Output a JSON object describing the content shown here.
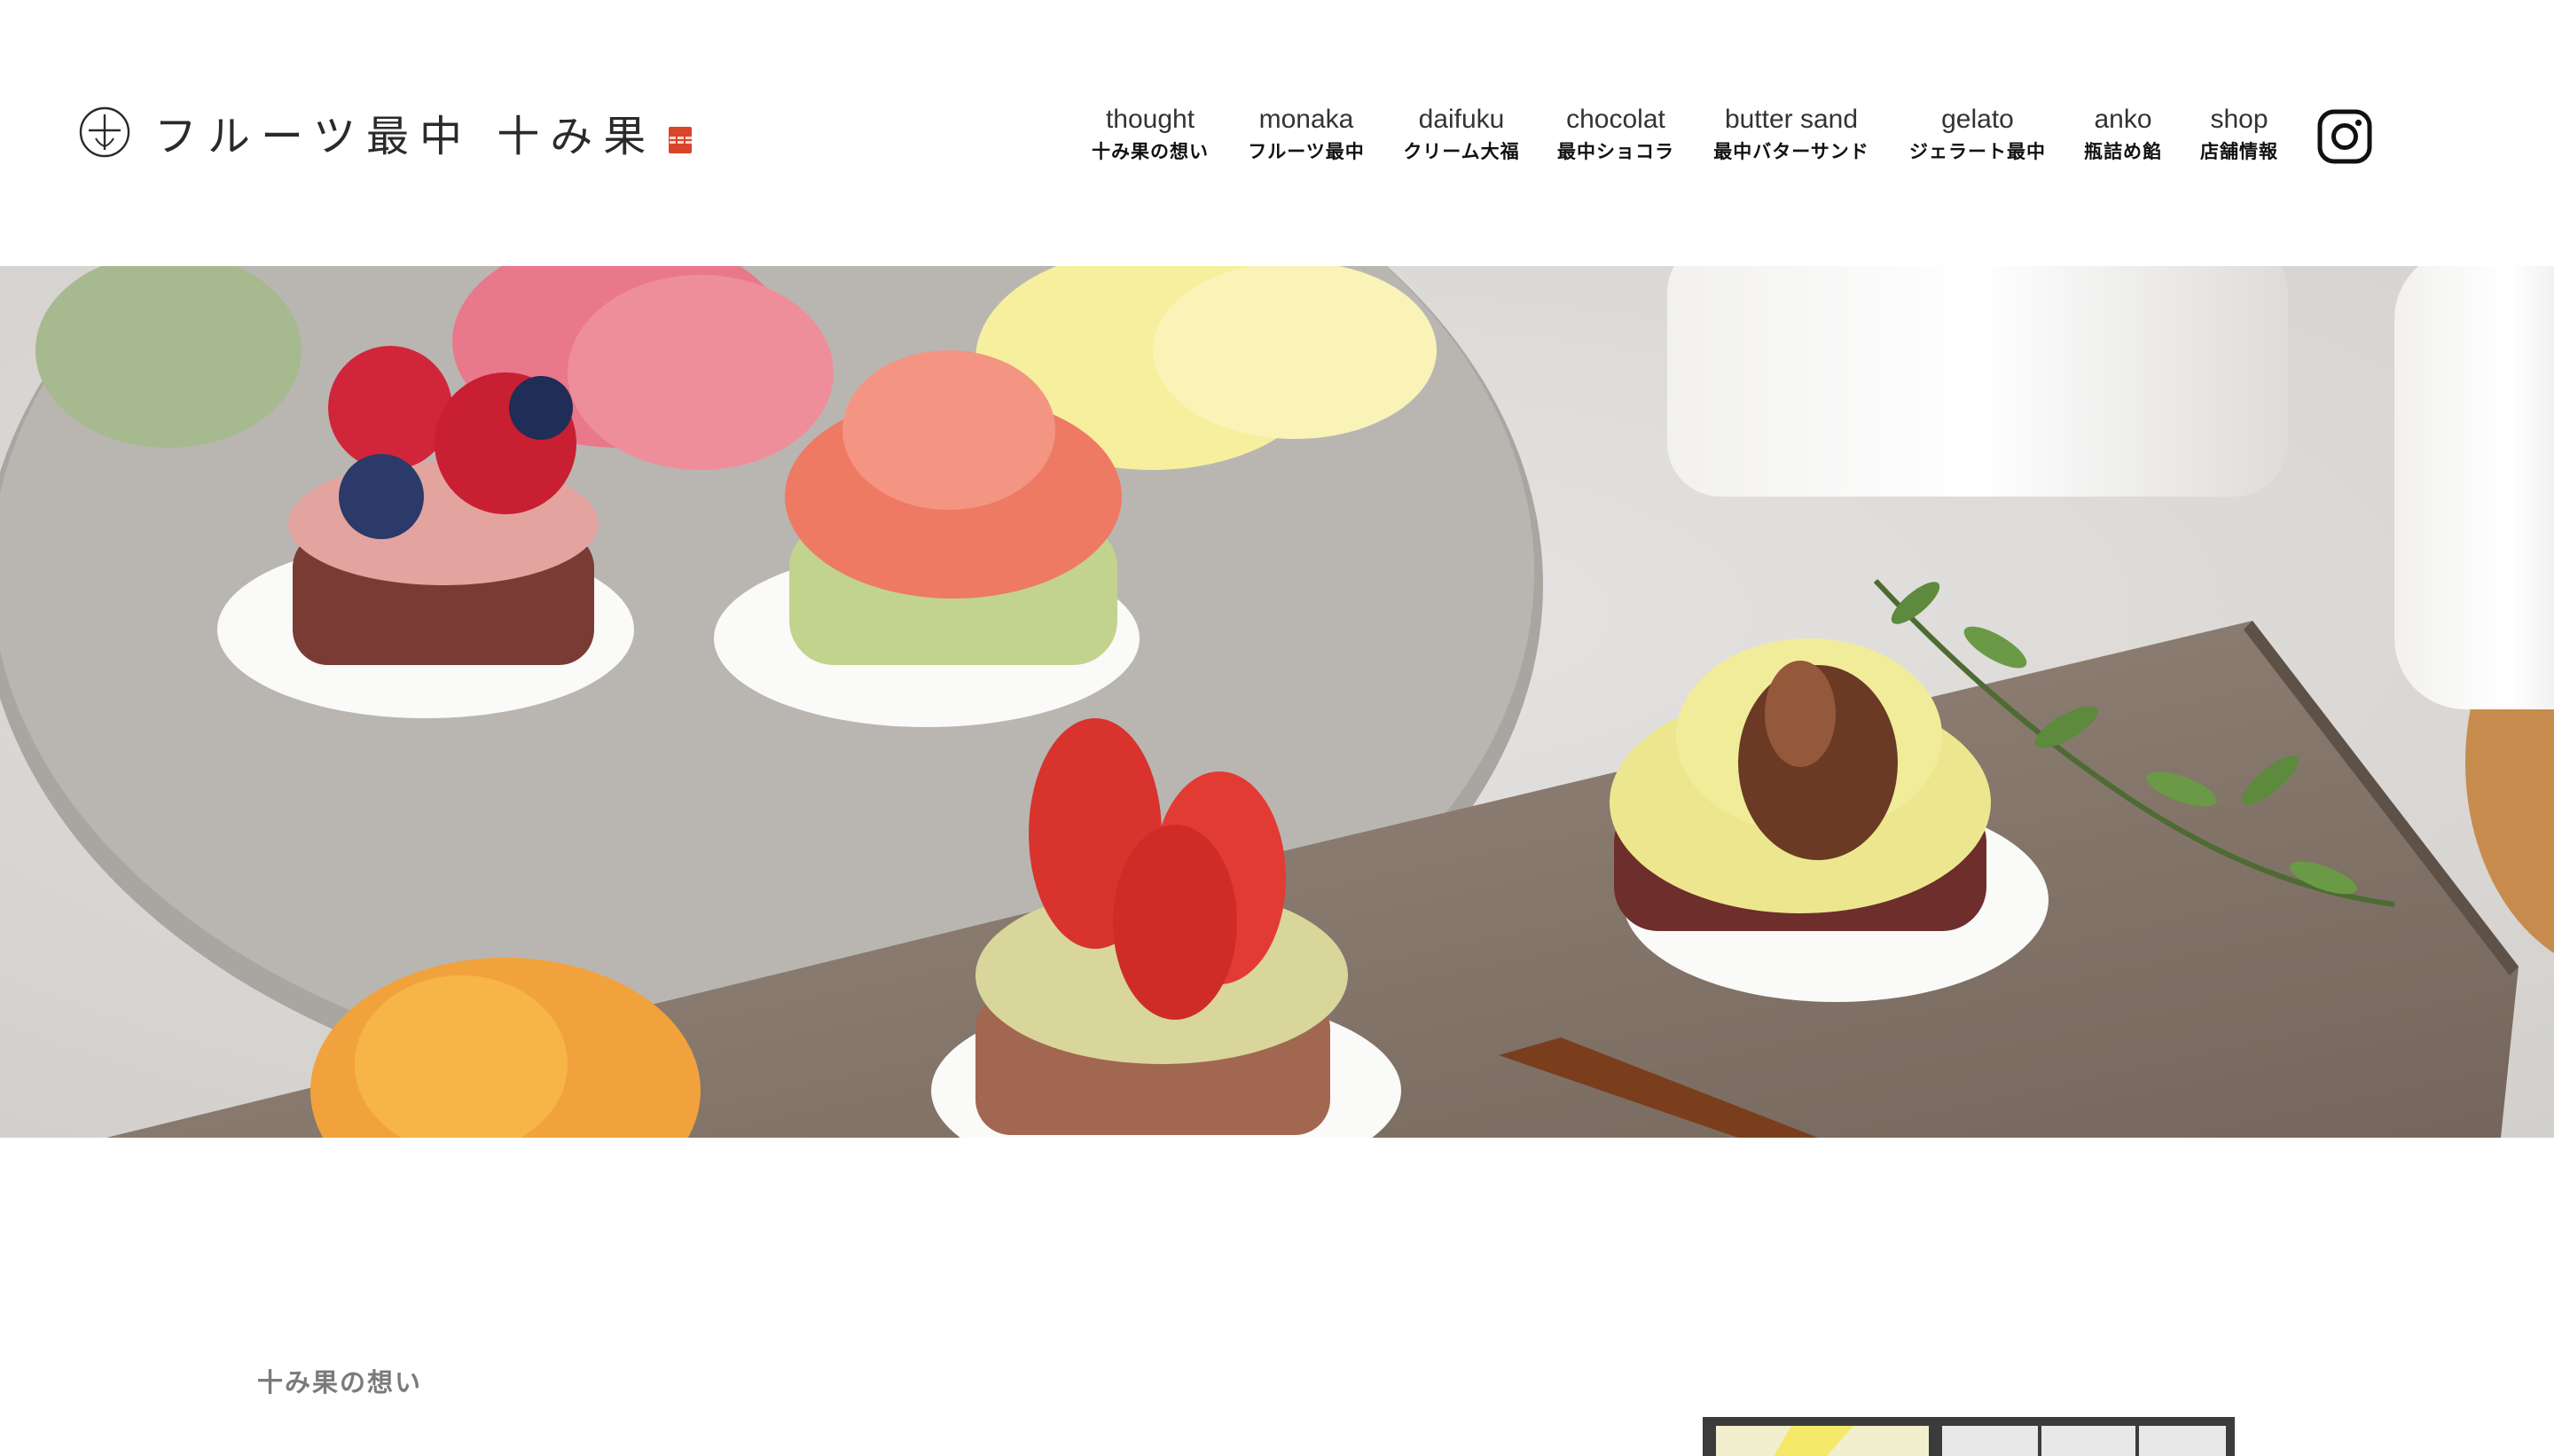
{
  "header": {
    "logo": {
      "name": "フルーツ最中 十み果",
      "mark_icon": "jumika-logo-mark",
      "seal_icon": "red-seal-stamp"
    },
    "nav": [
      {
        "en": "thought",
        "ja": "十み果の想い"
      },
      {
        "en": "monaka",
        "ja": "フルーツ最中"
      },
      {
        "en": "daifuku",
        "ja": "クリーム大福"
      },
      {
        "en": "chocolat",
        "ja": "最中ショコラ"
      },
      {
        "en": "butter sand",
        "ja": "最中バターサンド"
      },
      {
        "en": "gelato",
        "ja": "ジェラート最中"
      },
      {
        "en": "anko",
        "ja": "瓶詰め餡"
      },
      {
        "en": "shop",
        "ja": "店舗情報"
      }
    ],
    "social_icon": "instagram-icon"
  },
  "hero": {
    "image": "fruit monaka sweets on plates",
    "colors": {
      "background": "#dcdad8",
      "plate": "#b8b5b1",
      "board": "#8a7b70",
      "strawberry": "#d8332d",
      "chestnut": "#6b3a24"
    }
  },
  "section": {
    "title": "十み果の想い"
  }
}
